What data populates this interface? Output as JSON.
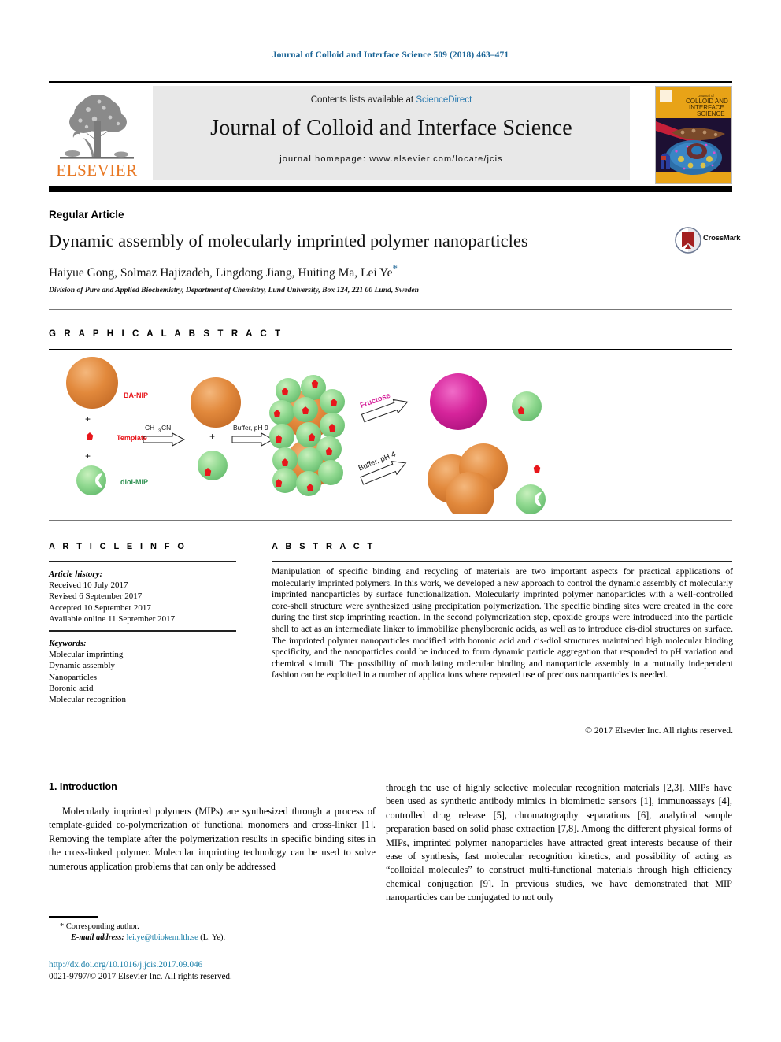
{
  "running_head": "Journal of Colloid and Interface Science 509 (2018) 463–471",
  "masthead": {
    "contents_prefix": "Contents lists available at ",
    "sciencedirect": "ScienceDirect",
    "journal_name": "Journal of Colloid and Interface Science",
    "homepage": "journal homepage: www.elsevier.com/locate/jcis",
    "publisher": "ELSEVIER",
    "cover_title_line1": "COLLOID AND",
    "cover_title_line2": "INTERFACE",
    "cover_title_line3": "SCIENCE",
    "cover_kicker": "Journal of"
  },
  "article": {
    "type": "Regular Article",
    "title": "Dynamic assembly of molecularly imprinted polymer nanoparticles",
    "crossmark_label": "CrossMark",
    "authors": "Haiyue Gong, Solmaz Hajizadeh, Lingdong Jiang, Huiting Ma, Lei Ye",
    "corresponding_marker": "*",
    "affiliation": "Division of Pure and Applied Biochemistry, Department of Chemistry, Lund University, Box 124, 221 00 Lund, Sweden"
  },
  "graphical_abstract": {
    "heading": "G R A P H I C A L   A B S T R A C T",
    "labels": {
      "ba_nip": "BA-NIP",
      "template": "Template",
      "diol_mip": "diol-MIP",
      "plus1": "+",
      "plus2": "+",
      "plus3": "+",
      "arrow1": "CH₃CN",
      "arrow2": "Buffer, pH 9",
      "arrow3": "Fructose",
      "arrow4": "Buffer, pH 4"
    },
    "colors": {
      "orange": "#E08A3C",
      "green": "#8FD88F",
      "red": "#E8161B",
      "magenta": "#D6249B",
      "label_red": "#E8161B",
      "label_green": "#2C8F4F",
      "label_magenta": "#D6249B"
    }
  },
  "article_info": {
    "heading": "A R T I C L E   I N F O",
    "history_label": "Article history:",
    "history": [
      "Received 10 July 2017",
      "Revised 6 September 2017",
      "Accepted 10 September 2017",
      "Available online 11 September 2017"
    ],
    "keywords_label": "Keywords:",
    "keywords": [
      "Molecular imprinting",
      "Dynamic assembly",
      "Nanoparticles",
      "Boronic acid",
      "Molecular recognition"
    ]
  },
  "abstract": {
    "heading": "A B S T R A C T",
    "text": "Manipulation of specific binding and recycling of materials are two important aspects for practical applications of molecularly imprinted polymers. In this work, we developed a new approach to control the dynamic assembly of molecularly imprinted nanoparticles by surface functionalization. Molecularly imprinted polymer nanoparticles with a well-controlled core-shell structure were synthesized using precipitation polymerization. The specific binding sites were created in the core during the first step imprinting reaction. In the second polymerization step, epoxide groups were introduced into the particle shell to act as an intermediate linker to immobilize phenylboronic acids, as well as to introduce cis-diol structures on surface. The imprinted polymer nanoparticles modified with boronic acid and cis-diol structures maintained high molecular binding specificity, and the nanoparticles could be induced to form dynamic particle aggregation that responded to pH variation and chemical stimuli. The possibility of modulating molecular binding and nanoparticle assembly in a mutually independent fashion can be exploited in a number of applications where repeated use of precious nanoparticles is needed.",
    "copyright": "© 2017 Elsevier Inc. All rights reserved."
  },
  "body": {
    "section_heading": "1. Introduction",
    "left_col_text": "Molecularly imprinted polymers (MIPs) are synthesized through a process of template-guided co-polymerization of functional monomers and cross-linker [1]. Removing the template after the polymerization results in specific binding sites in the cross-linked polymer. Molecular imprinting technology can be used to solve numerous application problems that can only be addressed",
    "right_col_text": "through the use of highly selective molecular recognition materials [2,3]. MIPs have been used as synthetic antibody mimics in biomimetic sensors [1], immunoassays [4], controlled drug release [5], chromatography separations [6], analytical sample preparation based on solid phase extraction [7,8]. Among the different physical forms of MIPs, imprinted polymer nanoparticles have attracted great interests because of their ease of synthesis, fast molecular recognition kinetics, and possibility of acting as “colloidal molecules” to construct multi-functional materials through high efficiency chemical conjugation [9]. In previous studies, we have demonstrated that MIP nanoparticles can be conjugated to not only"
  },
  "footer": {
    "corresponding_marker": "*",
    "corresponding_label": "Corresponding author.",
    "email_label": "E-mail address:",
    "email": "lei.ye@tbiokem.lth.se",
    "email_suffix": "(L. Ye).",
    "doi": "http://dx.doi.org/10.1016/j.jcis.2017.09.046",
    "issn_line": "0021-9797/© 2017 Elsevier Inc. All rights reserved."
  }
}
